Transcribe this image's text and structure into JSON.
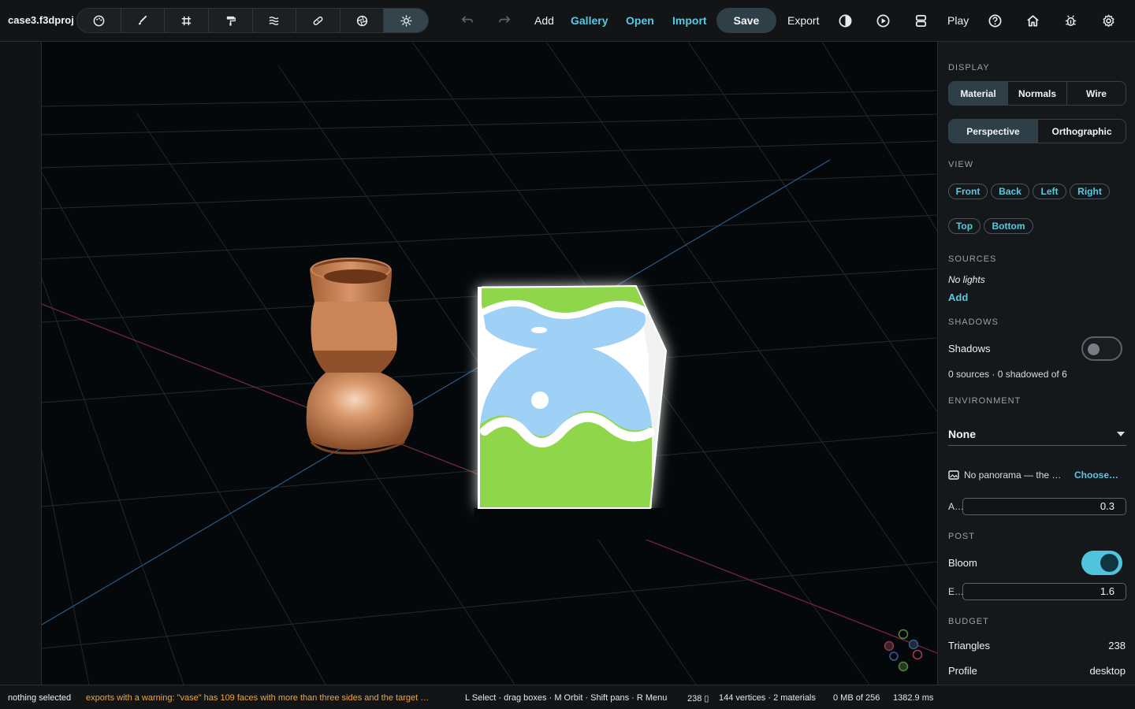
{
  "app": {
    "project_name": "case3.f3dproj"
  },
  "toolbar": {
    "tools": [
      {
        "name": "palette-tool",
        "icon": "palette-icon"
      },
      {
        "name": "brush-tool",
        "icon": "brush-icon"
      },
      {
        "name": "grid-tool",
        "icon": "grid-icon"
      },
      {
        "name": "paint-roller-tool",
        "icon": "paint-roller-icon"
      },
      {
        "name": "waves-tool",
        "icon": "waves-icon"
      },
      {
        "name": "bandage-tool",
        "icon": "bandage-icon"
      },
      {
        "name": "aperture-tool",
        "icon": "aperture-icon"
      },
      {
        "name": "light-tool",
        "icon": "sun-icon",
        "active": true
      }
    ],
    "add_label": "Add",
    "gallery_label": "Gallery",
    "open_label": "Open",
    "import_label": "Import",
    "save_label": "Save",
    "export_label": "Export",
    "play_label": "Play"
  },
  "panel": {
    "display": {
      "title": "DISPLAY",
      "modes": [
        "Material",
        "Normals",
        "Wire"
      ],
      "active_mode": "Material",
      "projections": [
        "Perspective",
        "Orthographic"
      ],
      "active_projection": "Perspective"
    },
    "view": {
      "title": "VIEW",
      "buttons": [
        "Front",
        "Back",
        "Left",
        "Right",
        "Top",
        "Bottom"
      ]
    },
    "sources": {
      "title": "SOURCES",
      "empty_text": "No lights",
      "add_label": "Add"
    },
    "shadows": {
      "title": "SHADOWS",
      "label": "Shadows",
      "enabled": false,
      "summary": "0 sources · 0 shadowed of 6"
    },
    "environment": {
      "title": "ENVIRONMENT",
      "selected": "None",
      "panorama_text": "No panorama — the …",
      "choose_label": "Choose…",
      "amount_label": "A…",
      "amount_value": "0.3"
    },
    "post": {
      "title": "POST",
      "bloom_label": "Bloom",
      "bloom_enabled": true,
      "exposure_label": "E…",
      "exposure_value": "1.6"
    },
    "budget": {
      "title": "BUDGET",
      "triangles_label": "Triangles",
      "triangles_value": "238",
      "profile_label": "Profile",
      "profile_value": "desktop"
    }
  },
  "status": {
    "selection": "nothing selected",
    "warning": "exports with a warning: \"vase\" has 109 faces with more than three sides and the target …",
    "hints": "L Select · drag boxes · M Orbit · Shift pans · R Menu",
    "triangles": "238 ▯",
    "vertices": "144 vertices · 2 materials",
    "memory": "0 MB of 256",
    "frame_time": "1382.9 ms"
  },
  "colors": {
    "accent": "#58c9e3",
    "warning": "#f0a63c",
    "vase": "#c98b60",
    "logo_green": "#8fd64a",
    "logo_blue": "#9fd0f5"
  }
}
